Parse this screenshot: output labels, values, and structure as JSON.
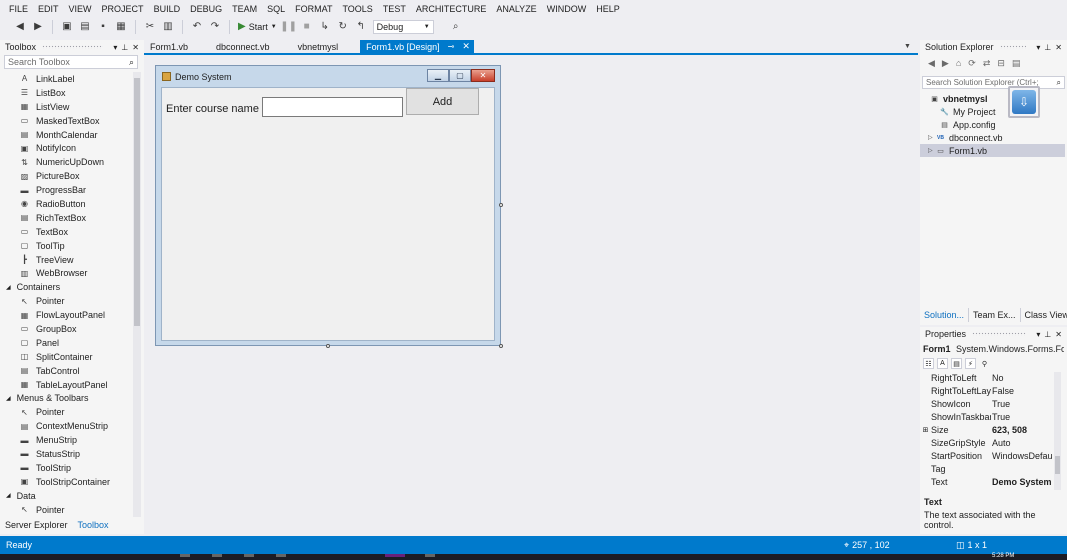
{
  "menu": [
    "FILE",
    "EDIT",
    "VIEW",
    "PROJECT",
    "BUILD",
    "DEBUG",
    "TEAM",
    "SQL",
    "FORMAT",
    "TOOLS",
    "TEST",
    "ARCHITECTURE",
    "ANALYZE",
    "WINDOW",
    "HELP"
  ],
  "toolbar": {
    "start_label": "Start",
    "config_value": "Debug",
    "icons": [
      "back-icon",
      "forward-icon",
      "new-project-icon",
      "open-icon",
      "save-icon",
      "save-all-icon",
      "undo-icon",
      "redo-icon",
      "start-icon",
      "pause-icon",
      "stop-icon",
      "step-icon",
      "find-icon"
    ]
  },
  "toolbox": {
    "title": "Toolbox",
    "search_placeholder": "Search Toolbox",
    "entries": [
      {
        "kind": "item",
        "label": "LinkLabel",
        "icon": "A"
      },
      {
        "kind": "item",
        "label": "ListBox",
        "icon": "☰"
      },
      {
        "kind": "item",
        "label": "ListView",
        "icon": "▦"
      },
      {
        "kind": "item",
        "label": "MaskedTextBox",
        "icon": "▭"
      },
      {
        "kind": "item",
        "label": "MonthCalendar",
        "icon": "▤"
      },
      {
        "kind": "item",
        "label": "NotifyIcon",
        "icon": "▣"
      },
      {
        "kind": "item",
        "label": "NumericUpDown",
        "icon": "⇅"
      },
      {
        "kind": "item",
        "label": "PictureBox",
        "icon": "▨"
      },
      {
        "kind": "item",
        "label": "ProgressBar",
        "icon": "▬"
      },
      {
        "kind": "item",
        "label": "RadioButton",
        "icon": "◉"
      },
      {
        "kind": "item",
        "label": "RichTextBox",
        "icon": "▤"
      },
      {
        "kind": "item",
        "label": "TextBox",
        "icon": "▭"
      },
      {
        "kind": "item",
        "label": "ToolTip",
        "icon": "▢"
      },
      {
        "kind": "item",
        "label": "TreeView",
        "icon": "┣"
      },
      {
        "kind": "item",
        "label": "WebBrowser",
        "icon": "▥"
      },
      {
        "kind": "cat",
        "label": "Containers"
      },
      {
        "kind": "item",
        "label": "Pointer",
        "icon": "↖"
      },
      {
        "kind": "item",
        "label": "FlowLayoutPanel",
        "icon": "▦"
      },
      {
        "kind": "item",
        "label": "GroupBox",
        "icon": "▭"
      },
      {
        "kind": "item",
        "label": "Panel",
        "icon": "▢"
      },
      {
        "kind": "item",
        "label": "SplitContainer",
        "icon": "◫"
      },
      {
        "kind": "item",
        "label": "TabControl",
        "icon": "▤"
      },
      {
        "kind": "item",
        "label": "TableLayoutPanel",
        "icon": "▦"
      },
      {
        "kind": "cat",
        "label": "Menus & Toolbars"
      },
      {
        "kind": "item",
        "label": "Pointer",
        "icon": "↖"
      },
      {
        "kind": "item",
        "label": "ContextMenuStrip",
        "icon": "▤"
      },
      {
        "kind": "item",
        "label": "MenuStrip",
        "icon": "▬"
      },
      {
        "kind": "item",
        "label": "StatusStrip",
        "icon": "▬"
      },
      {
        "kind": "item",
        "label": "ToolStrip",
        "icon": "▬"
      },
      {
        "kind": "item",
        "label": "ToolStripContainer",
        "icon": "▣"
      },
      {
        "kind": "cat",
        "label": "Data"
      },
      {
        "kind": "item",
        "label": "Pointer",
        "icon": "↖"
      }
    ],
    "bottom_tabs": [
      {
        "label": "Server Explorer",
        "active": false
      },
      {
        "label": "Toolbox",
        "active": true
      }
    ]
  },
  "doc_tabs": [
    {
      "label": "Form1.vb",
      "active": false
    },
    {
      "label": "dbconnect.vb",
      "active": false
    },
    {
      "label": "vbnetmysl",
      "active": false
    },
    {
      "label": "Form1.vb [Design]",
      "active": true
    }
  ],
  "form": {
    "title": "Demo System",
    "label_text": "Enter course name",
    "button_label": "Add",
    "textbox_value": ""
  },
  "solution_explorer": {
    "title": "Solution Explorer",
    "search_placeholder": "Search Solution Explorer (Ctrl+;",
    "tree": [
      {
        "label": "vbnetmysl",
        "level": 0,
        "bold": true,
        "expander": "",
        "icon": "▣"
      },
      {
        "label": "My Project",
        "level": 1,
        "bold": false,
        "expander": "",
        "icon": "🔧"
      },
      {
        "label": "App.config",
        "level": 1,
        "bold": false,
        "expander": "",
        "icon": "▤"
      },
      {
        "label": "dbconnect.vb",
        "level": 1,
        "bold": false,
        "expander": "▷",
        "icon": "VB"
      },
      {
        "label": "Form1.vb",
        "level": 1,
        "bold": false,
        "expander": "▷",
        "icon": "▭",
        "selected": true
      }
    ],
    "bottom_tabs": [
      {
        "label": "Solution...",
        "active": true
      },
      {
        "label": "Team Ex...",
        "active": false
      },
      {
        "label": "Class View",
        "active": false
      }
    ]
  },
  "properties": {
    "title": "Properties",
    "object_name": "Form1",
    "object_type": "System.Windows.Forms.Forr",
    "rows": [
      {
        "name": "RightToLeft",
        "value": "No",
        "bold": false,
        "expand": ""
      },
      {
        "name": "RightToLeftLayo",
        "value": "False",
        "bold": false,
        "expand": ""
      },
      {
        "name": "ShowIcon",
        "value": "True",
        "bold": false,
        "expand": ""
      },
      {
        "name": "ShowInTaskbar",
        "value": "True",
        "bold": false,
        "expand": ""
      },
      {
        "name": "Size",
        "value": "623, 508",
        "bold": true,
        "expand": "⊞"
      },
      {
        "name": "SizeGripStyle",
        "value": "Auto",
        "bold": false,
        "expand": ""
      },
      {
        "name": "StartPosition",
        "value": "WindowsDefault",
        "bold": false,
        "expand": ""
      },
      {
        "name": "Tag",
        "value": "",
        "bold": false,
        "expand": ""
      },
      {
        "name": "Text",
        "value": "Demo System",
        "bold": true,
        "expand": ""
      }
    ],
    "desc_title": "Text",
    "desc_text": "The text associated with the control."
  },
  "status": {
    "ready": "Ready",
    "position": "257 , 102",
    "size": "1 x 1"
  },
  "taskbar": {
    "clock": "5:28 PM"
  },
  "colors": {
    "accent": "#007acc",
    "status_bar": "#007acc",
    "selection": "#cccedb"
  }
}
